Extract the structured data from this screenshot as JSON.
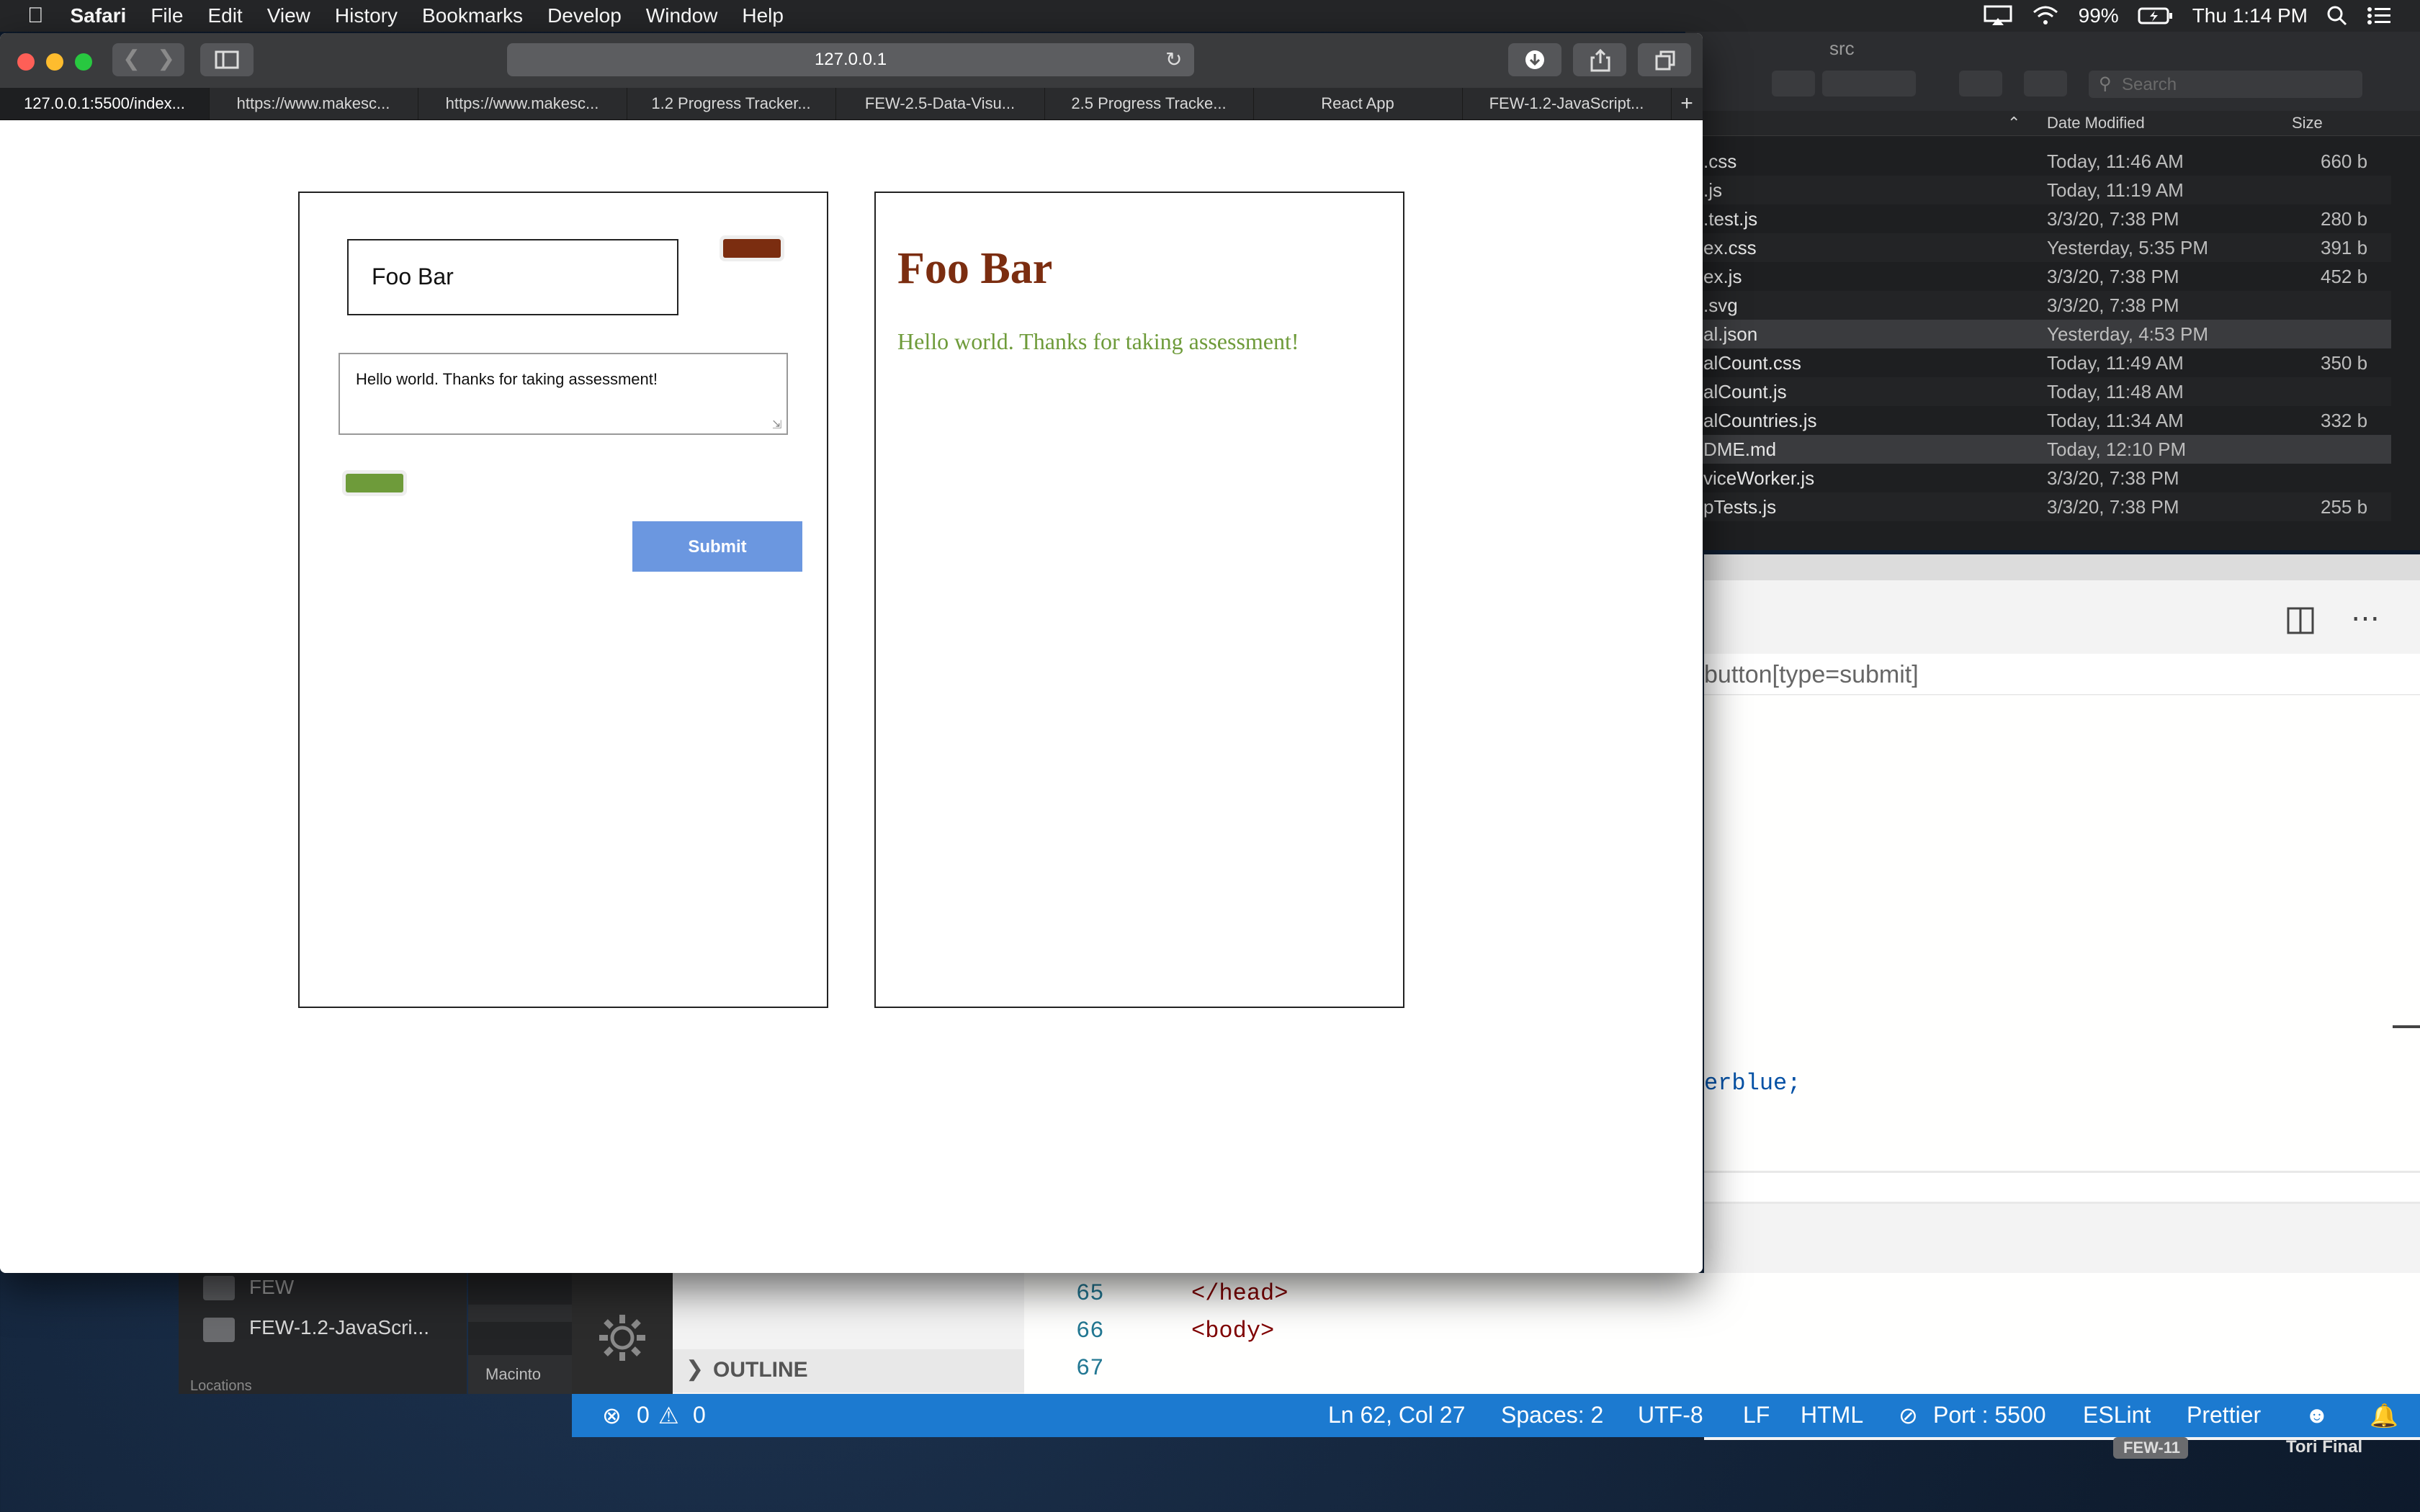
{
  "menubar": {
    "apple": "",
    "items": [
      "Safari",
      "File",
      "Edit",
      "View",
      "History",
      "Bookmarks",
      "Develop",
      "Window",
      "Help"
    ],
    "battery": "99%",
    "clock": "Thu 1:14 PM"
  },
  "safari": {
    "address": "127.0.0.1",
    "tabs": [
      "127.0.0.1:5500/index...",
      "https://www.makesc...",
      "https://www.makesc...",
      "1.2 Progress Tracker...",
      "FEW-2.5-Data-Visu...",
      "2.5 Progress Tracke...",
      "React App",
      "FEW-1.2-JavaScript..."
    ],
    "new_tab": "+"
  },
  "page": {
    "name_value": "Foo Bar",
    "message_value": "Hello world. Thanks for taking assessment!",
    "submit_label": "Submit",
    "preview_title": "Foo Bar",
    "preview_message": "Hello world. Thanks for taking assessment!",
    "colors": {
      "title": "#7b2d10",
      "message": "#6e9b3a",
      "submit": "#6b97e0"
    }
  },
  "finder": {
    "title": "src",
    "search_placeholder": "Search",
    "col_modified": "Date Modified",
    "col_size": "Size",
    "rows": [
      {
        "name": ".css",
        "modified": "Today, 11:46 AM",
        "size": "660 b"
      },
      {
        "name": ".js",
        "modified": "Today, 11:19 AM",
        "size": ""
      },
      {
        "name": ".test.js",
        "modified": "3/3/20, 7:38 PM",
        "size": "280 b"
      },
      {
        "name": "ex.css",
        "modified": "Yesterday, 5:35 PM",
        "size": "391 b"
      },
      {
        "name": "ex.js",
        "modified": "3/3/20, 7:38 PM",
        "size": "452 b"
      },
      {
        "name": ".svg",
        "modified": "3/3/20, 7:38 PM",
        "size": ""
      },
      {
        "name": "al.json",
        "modified": "Yesterday, 4:53 PM",
        "size": ""
      },
      {
        "name": "alCount.css",
        "modified": "Today, 11:49 AM",
        "size": "350 b"
      },
      {
        "name": "alCount.js",
        "modified": "Today, 11:48 AM",
        "size": ""
      },
      {
        "name": "alCountries.js",
        "modified": "Today, 11:34 AM",
        "size": "332 b"
      },
      {
        "name": "DME.md",
        "modified": "Today, 12:10 PM",
        "size": ""
      },
      {
        "name": "viceWorker.js",
        "modified": "3/3/20, 7:38 PM",
        "size": ""
      },
      {
        "name": "pTests.js",
        "modified": "3/3/20, 7:38 PM",
        "size": "255 b"
      }
    ]
  },
  "vscode": {
    "breadcrumb": "button[type=submit]",
    "code_fragment": "erblue;",
    "line_numbers": [
      "65",
      "66",
      "67"
    ],
    "lines": [
      "</head>",
      "<body>",
      ""
    ],
    "outline_label": "OUTLINE",
    "status": {
      "errors": "0",
      "warnings": "0",
      "position": "Ln 62, Col 27",
      "spaces": "Spaces: 2",
      "encoding": "UTF-8",
      "eol": "LF",
      "language": "HTML",
      "port": "Port : 5500",
      "eslint": "ESLint",
      "prettier": "Prettier"
    }
  },
  "sidebar_behind": {
    "items": [
      "FEW",
      "FEW-1.2-JavaScri..."
    ],
    "locations_label": "Locations",
    "disk_label": "Macinto"
  },
  "desktop": {
    "badge": "FEW-11",
    "folder": "Tori Final"
  }
}
